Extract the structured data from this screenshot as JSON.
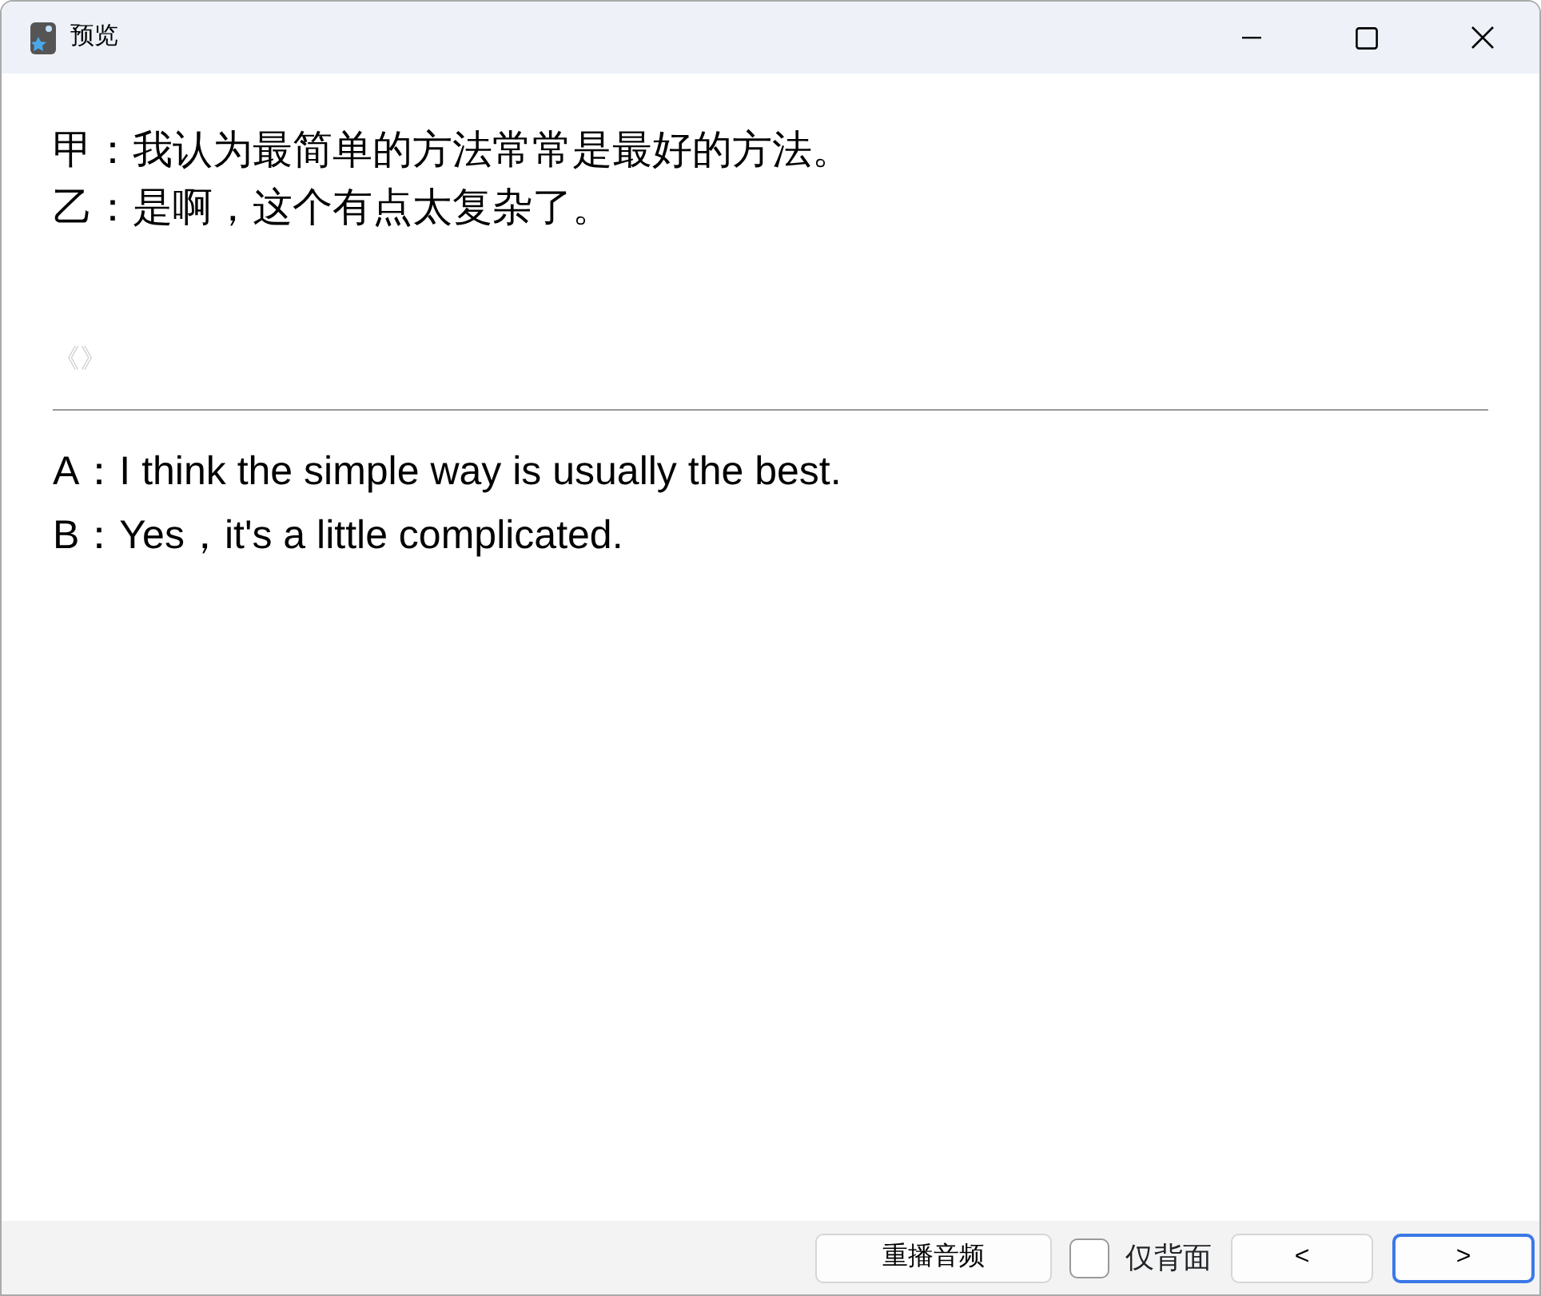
{
  "window": {
    "title": "预览"
  },
  "front": {
    "lines": [
      "甲：我认为最简单的方法常常是最好的方法。",
      "乙：是啊，这个有点太复杂了。"
    ],
    "marker": "《》"
  },
  "back": {
    "lines": [
      "A：I think the simple way is usually the best.",
      "B：Yes，it's a little complicated."
    ]
  },
  "footer": {
    "replay_button": "重播音频",
    "checkbox": {
      "label": "仅背面",
      "checked": false
    },
    "nav_buttons": [
      {
        "label": "<",
        "focused": false
      },
      {
        "label": ">",
        "focused": true
      }
    ]
  }
}
